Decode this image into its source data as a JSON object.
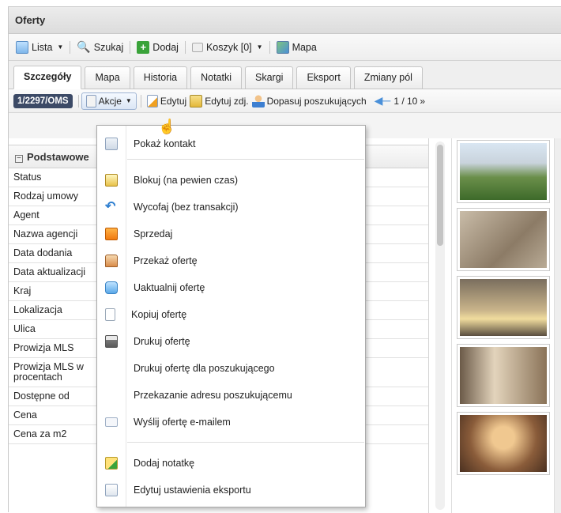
{
  "window": {
    "title": "Oferty"
  },
  "toolbar": {
    "lista_label": "Lista",
    "szukaj_label": "Szukaj",
    "dodaj_label": "Dodaj",
    "koszyk_label": "Koszyk [0]",
    "mapa_label": "Mapa"
  },
  "tabs": [
    {
      "label": "Szczegóły"
    },
    {
      "label": "Mapa"
    },
    {
      "label": "Historia"
    },
    {
      "label": "Notatki"
    },
    {
      "label": "Skargi"
    },
    {
      "label": "Eksport"
    },
    {
      "label": "Zmiany pól"
    }
  ],
  "actionbar": {
    "offer_id": "1/2297/OMS",
    "akcje_label": "Akcje",
    "edytuj_label": "Edytuj",
    "edytuj_zdj_label": "Edytuj zdj.",
    "dopasuj_label": "Dopasuj poszukujących",
    "pager": "1 / 10"
  },
  "details": {
    "section_title": "Podstawowe",
    "rows": [
      "Status",
      "Rodzaj umowy",
      "Agent",
      "Nazwa agencji",
      "Data dodania",
      "Data aktualizacji",
      "Kraj",
      "Lokalizacja",
      "Ulica",
      "Prowizja MLS",
      "Prowizja MLS w procentach",
      "Dostępne od",
      "Cena",
      "Cena za m2"
    ]
  },
  "menu": {
    "items": [
      {
        "label": "Pokaż kontakt",
        "icon": "contact-card-icon"
      },
      {
        "label": "Blokuj (na pewien czas)",
        "icon": "lock-calendar-icon"
      },
      {
        "label": "Wycofaj (bez transakcji)",
        "icon": "undo-arrow-icon"
      },
      {
        "label": "Sprzedaj",
        "icon": "sell-document-icon"
      },
      {
        "label": "Przekaż ofertę",
        "icon": "house-person-icon"
      },
      {
        "label": "Uaktualnij ofertę",
        "icon": "refresh-icon"
      },
      {
        "label": "Kopiuj ofertę",
        "icon": "copy-icon"
      },
      {
        "label": "Drukuj ofertę",
        "icon": "printer-icon"
      },
      {
        "label": "Drukuj ofertę dla poszukującego",
        "icon": ""
      },
      {
        "label": "Przekazanie adresu poszukującemu",
        "icon": ""
      },
      {
        "label": "Wyślij ofertę e-mailem",
        "icon": "envelope-icon"
      },
      {
        "label": "Dodaj notatkę",
        "icon": "add-note-icon"
      },
      {
        "label": "Edytuj ustawienia eksportu",
        "icon": "export-settings-icon"
      }
    ]
  },
  "colors": {
    "badge": "#3c4a66",
    "accent_blue": "#2f7fd0",
    "add_green": "#3aa33a"
  }
}
